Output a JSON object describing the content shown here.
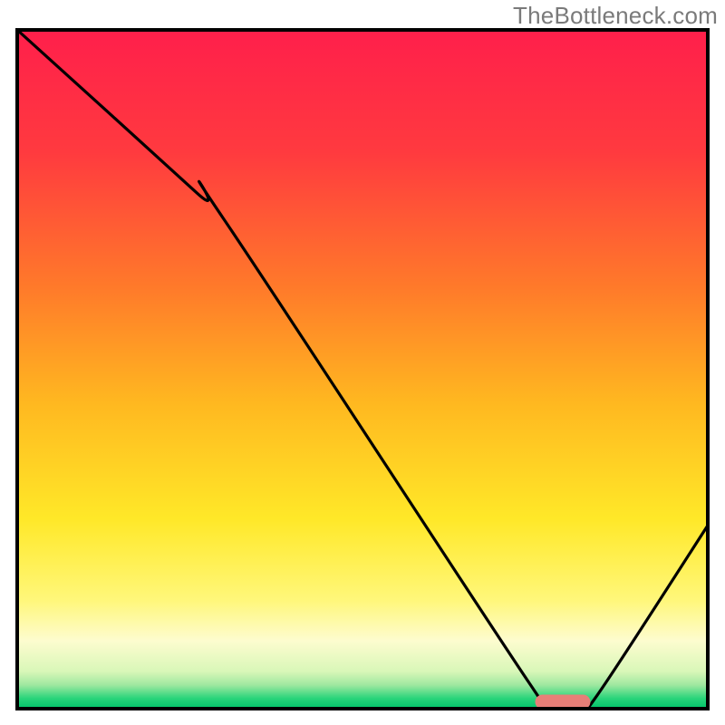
{
  "watermark": "TheBottleneck.com",
  "chart_data": {
    "type": "line",
    "title": "",
    "xlabel": "",
    "ylabel": "",
    "xlim": [
      0,
      100
    ],
    "ylim": [
      0,
      100
    ],
    "gradient_stops": [
      {
        "offset": 0.0,
        "color": "#ff1f4b"
      },
      {
        "offset": 0.18,
        "color": "#ff3a3f"
      },
      {
        "offset": 0.38,
        "color": "#ff7a2a"
      },
      {
        "offset": 0.55,
        "color": "#ffb820"
      },
      {
        "offset": 0.72,
        "color": "#ffe828"
      },
      {
        "offset": 0.84,
        "color": "#fff77a"
      },
      {
        "offset": 0.9,
        "color": "#fdfccf"
      },
      {
        "offset": 0.945,
        "color": "#d9f7b8"
      },
      {
        "offset": 0.965,
        "color": "#9fe8a0"
      },
      {
        "offset": 0.985,
        "color": "#28d47a"
      },
      {
        "offset": 1.0,
        "color": "#00c46a"
      }
    ],
    "series": [
      {
        "name": "bottleneck-curve",
        "x": [
          0,
          26,
          30,
          74,
          77,
          82,
          84,
          100
        ],
        "y": [
          100,
          76,
          72,
          4,
          1,
          1,
          2,
          27
        ]
      }
    ],
    "marker": {
      "name": "optimal-range",
      "x_start": 75,
      "x_end": 83,
      "y": 1,
      "color": "#e77f78"
    },
    "frame_color": "#000000"
  }
}
